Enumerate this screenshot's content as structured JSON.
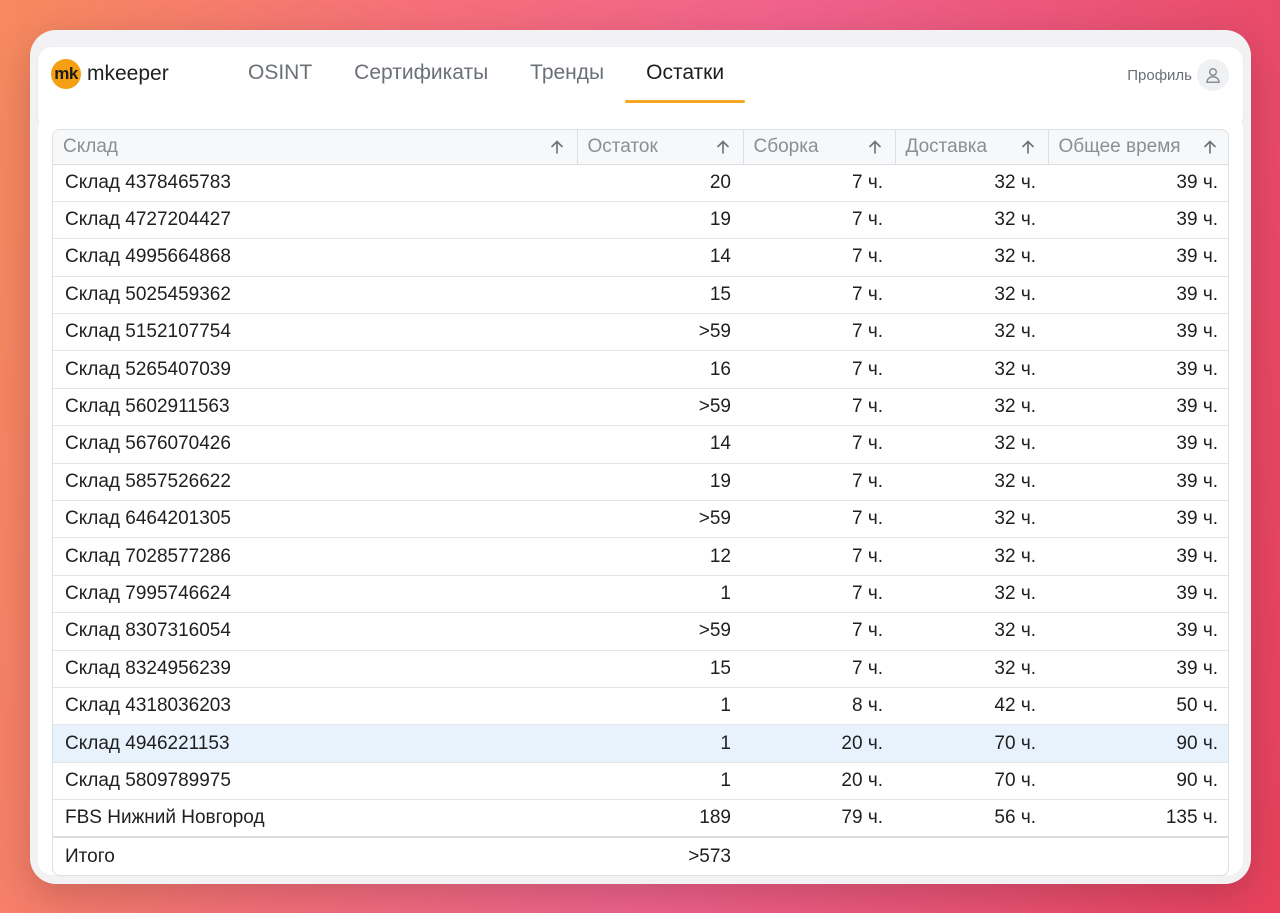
{
  "app": {
    "logo_mark": "mk",
    "logo_text": "mkeeper"
  },
  "nav": {
    "tabs": [
      "OSINT",
      "Сертификаты",
      "Тренды",
      "Остатки"
    ],
    "active": 3,
    "profile_label": "Профиль"
  },
  "colors": {
    "accent": "#f5a623",
    "logo": "#f5a012",
    "highlight_row": "#e8f2fd"
  },
  "table": {
    "headers": [
      "Склад",
      "Остаток",
      "Сборка",
      "Доставка",
      "Общее время"
    ],
    "rows": [
      [
        "Склад 4378465783",
        "20",
        "7 ч.",
        "32 ч.",
        "39 ч."
      ],
      [
        "Склад 4727204427",
        "19",
        "7 ч.",
        "32 ч.",
        "39 ч."
      ],
      [
        "Склад 4995664868",
        "14",
        "7 ч.",
        "32 ч.",
        "39 ч."
      ],
      [
        "Склад 5025459362",
        "15",
        "7 ч.",
        "32 ч.",
        "39 ч."
      ],
      [
        "Склад 5152107754",
        ">59",
        "7 ч.",
        "32 ч.",
        "39 ч."
      ],
      [
        "Склад 5265407039",
        "16",
        "7 ч.",
        "32 ч.",
        "39 ч."
      ],
      [
        "Склад 5602911563",
        ">59",
        "7 ч.",
        "32 ч.",
        "39 ч."
      ],
      [
        "Склад 5676070426",
        "14",
        "7 ч.",
        "32 ч.",
        "39 ч."
      ],
      [
        "Склад 5857526622",
        "19",
        "7 ч.",
        "32 ч.",
        "39 ч."
      ],
      [
        "Склад 6464201305",
        ">59",
        "7 ч.",
        "32 ч.",
        "39 ч."
      ],
      [
        "Склад 7028577286",
        "12",
        "7 ч.",
        "32 ч.",
        "39 ч."
      ],
      [
        "Склад 7995746624",
        "1",
        "7 ч.",
        "32 ч.",
        "39 ч."
      ],
      [
        "Склад 8307316054",
        ">59",
        "7 ч.",
        "32 ч.",
        "39 ч."
      ],
      [
        "Склад 8324956239",
        "15",
        "7 ч.",
        "32 ч.",
        "39 ч."
      ],
      [
        "Склад 4318036203",
        "1",
        "8 ч.",
        "42 ч.",
        "50 ч."
      ],
      [
        "Склад 4946221153",
        "1",
        "20 ч.",
        "70 ч.",
        "90 ч."
      ],
      [
        "Склад 5809789975",
        "1",
        "20 ч.",
        "70 ч.",
        "90 ч."
      ],
      [
        "FBS Нижний Новгород",
        "189",
        "79 ч.",
        "56 ч.",
        "135 ч."
      ]
    ],
    "highlighted_row": 15,
    "total": {
      "label": "Итого",
      "stock": ">573"
    }
  }
}
